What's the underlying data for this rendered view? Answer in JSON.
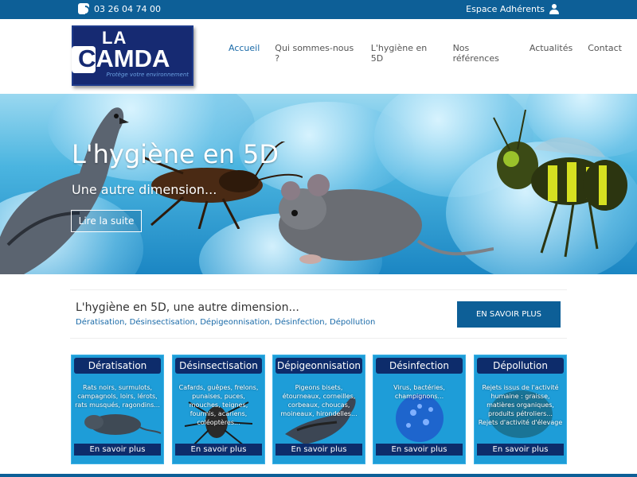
{
  "topbar": {
    "phone": "03 26 04 74 00",
    "member_area": "Espace Adhérents",
    "phone_icon": "phone-icon",
    "user_icon": "user-icon"
  },
  "header": {
    "logo": {
      "la": "LA",
      "name": "CAMDA",
      "tagline": "Protège votre environnement"
    },
    "nav": [
      {
        "label": "Accueil",
        "active": true
      },
      {
        "label": "Qui sommes-nous ?",
        "active": false
      },
      {
        "label": "L'hygiène en 5D",
        "active": false
      },
      {
        "label": "Nos références",
        "active": false
      },
      {
        "label": "Actualités",
        "active": false
      },
      {
        "label": "Contact",
        "active": false
      }
    ]
  },
  "hero": {
    "title": "L'hygiène en 5D",
    "subtitle": "Une autre dimension...",
    "button": "Lire la suite"
  },
  "intro": {
    "title": "L'hygiène en 5D, une autre dimension...",
    "links": "Dératisation, Désinsectisation, Dépigeonnisation, Désinfection, Dépollution",
    "button": "EN SAVOIR PLUS"
  },
  "cards": [
    {
      "title": "Dératisation",
      "text": "Rats noirs, surmulots, campagnols, loirs, lérots, rats musqués, ragondins...",
      "more": "En savoir plus",
      "art": "rat-icon"
    },
    {
      "title": "Désinsectisation",
      "text": "Cafards, guêpes, frelons, punaises, puces, mouches, teignes, fourmis, acariens, coléoptères...",
      "more": "En savoir plus",
      "art": "insect-icon"
    },
    {
      "title": "Dépigeonnisation",
      "text": "Pigeons bisets, étourneaux, corneilles, corbeaux, choucas, moineaux, hirondelles...",
      "more": "En savoir plus",
      "art": "pigeon-icon"
    },
    {
      "title": "Désinfection",
      "text": "Virus, bactéries, champignons...",
      "more": "En savoir plus",
      "art": "virus-icon"
    },
    {
      "title": "Dépollution",
      "text": "Rejets issus de l'activité humaine : graisse, matières organiques, produits pétroliers... Rejets d'activité d'élevage",
      "more": "En savoir plus",
      "art": "pollution-icon"
    }
  ],
  "colors": {
    "primary": "#0d5f97",
    "navy": "#0d2c6b",
    "card_blue": "#1e9dd8",
    "link": "#1a6aa8"
  }
}
